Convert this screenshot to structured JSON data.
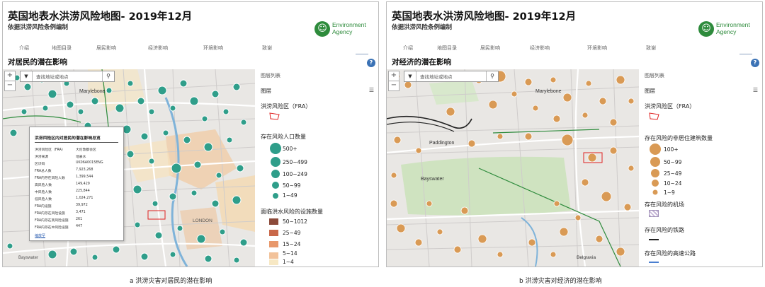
{
  "colors": {
    "flood_outline": "#e02020",
    "people_marker": "#2f9e8a",
    "building_marker": "#d99a55",
    "deprivation_1": "#f7e8c4",
    "deprivation_2": "#f2c29a",
    "deprivation_3": "#e8976a",
    "deprivation_4": "#c9684a",
    "deprivation_5": "#8c4a3a",
    "railway": "#222222",
    "motorway": "#4a7fd0",
    "env_agency_green": "#2e8b3c"
  },
  "panel_a": {
    "title": "英国地表水洪涝风险地图- 2019年12月",
    "subtitle": "依据洪涝风险条例编制",
    "logo_text": [
      "Environment",
      "Agency"
    ],
    "nav": [
      "介绍",
      "地图目录",
      "居民影响",
      "经济影响",
      "环境影响",
      "致谢"
    ],
    "section_title": "对居民的潜在影响",
    "search_placeholder": "查找地址或地点",
    "legend_header": "图层列表",
    "layers_label": "图层",
    "flood_area_label": "洪涝风险区（FRA）",
    "people_title": "存在风险人口数量",
    "people_classes": [
      "500+",
      "250~499",
      "100~249",
      "50~99",
      "1~49"
    ],
    "facility_title": "面临洪水风险的设施数量",
    "facility_classes": [
      "50~1012",
      "25~49",
      "15~24",
      "5~14",
      "1~4"
    ],
    "popup": {
      "title": "洪涝风险区内对居民的潜在影响总览",
      "rows": [
        {
          "k": "洪涝风险区（FRA）",
          "v": "大伦敦都会区"
        },
        {
          "k": "洪涝来源",
          "v": "地表水"
        },
        {
          "k": "区识码",
          "v": "UK06A0015ENG"
        },
        {
          "k": "FRA总人数",
          "v": "7,923,268"
        },
        {
          "k": "FRA内存在风险人数",
          "v": "1,399,544"
        },
        {
          "k": "高风险人数",
          "v": "149,429"
        },
        {
          "k": "中风险人数",
          "v": "225,844"
        },
        {
          "k": "低风险人数",
          "v": "1,024,271"
        },
        {
          "k": "FRA内设施",
          "v": "39,972"
        },
        {
          "k": "FRA内存在风险设施",
          "v": "3,471"
        },
        {
          "k": "FRA内存在高风险设施",
          "v": "261"
        },
        {
          "k": "FRA内存在中风险设施",
          "v": "447"
        }
      ],
      "link": "缩放至"
    },
    "map_labels": [
      "Marylebone",
      "LONDON",
      "Bayswater"
    ]
  },
  "panel_b": {
    "title": "英国地表水洪涝风险地图- 2019年12月",
    "subtitle": "依据洪涝风险条例编制",
    "logo_text": [
      "Environment",
      "Agency"
    ],
    "nav": [
      "介绍",
      "地图目录",
      "居民影响",
      "经济影响",
      "环境影响",
      "致谢"
    ],
    "section_title": "对经济的潜在影响",
    "search_placeholder": "查找地址或地点",
    "legend_header": "图层列表",
    "layers_label": "图层",
    "flood_area_label": "洪涝风险区（FRA）",
    "building_title": "存在风险的非居住建筑数量",
    "building_classes": [
      "100+",
      "50~99",
      "25~49",
      "10~24",
      "1~9"
    ],
    "airport_label": "存在风险的机场",
    "railway_label": "存在风险的铁路",
    "motorway_label": "存在风险的高速公路",
    "map_labels": [
      "Marylebone",
      "Paddington",
      "Bayswater",
      "Belgravia"
    ]
  },
  "captions": {
    "a": "a  洪涝灾害对居民的潜在影响",
    "b": "b  洪涝灾害对经济的潜在影响"
  }
}
